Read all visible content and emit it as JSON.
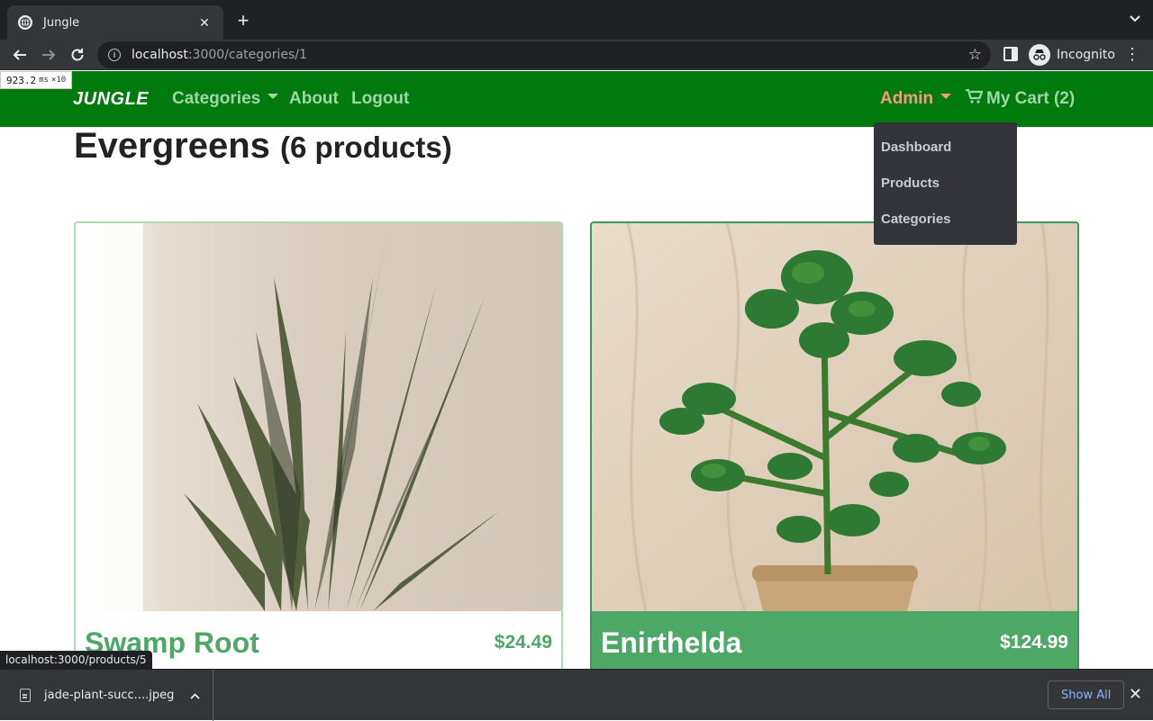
{
  "browser": {
    "tab_title": "Jungle",
    "url_host": "localhost",
    "url_path": ":3000/categories/1",
    "profile_label": "Incognito",
    "status_url": "localhost:3000/products/5"
  },
  "perf_overlay": {
    "value": "923.2",
    "unit": "ms",
    "multiplier": "×10"
  },
  "navbar": {
    "brand": "JUNGLE",
    "categories_label": "Categories",
    "about_label": "About",
    "logout_label": "Logout",
    "admin_label": "Admin",
    "cart_label": "My Cart (2)"
  },
  "admin_dropdown": {
    "items": [
      {
        "label": "Dashboard"
      },
      {
        "label": "Products"
      },
      {
        "label": "Categories"
      }
    ]
  },
  "page": {
    "title": "Evergreens",
    "count": "(6 products)"
  },
  "products": [
    {
      "name": "Swamp Root",
      "price": "$24.49"
    },
    {
      "name": "Enirthelda",
      "price": "$124.99"
    }
  ],
  "downloads": {
    "file_name": "jade-plant-succ....jpeg",
    "show_all_label": "Show All"
  },
  "colors": {
    "navbar": "#007a0d",
    "nav_link": "#9fd6a6",
    "admin": "#f49b7f",
    "product_green": "#4da866"
  }
}
